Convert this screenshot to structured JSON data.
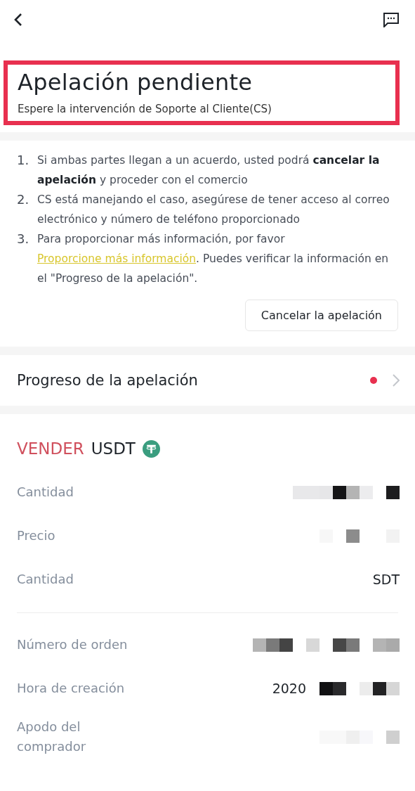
{
  "header": {
    "title": "Apelación pendiente",
    "subtitle": "Espere la intervención de Soporte al Cliente(CS)"
  },
  "steps": [
    {
      "number": "1.",
      "text": "Si ambas partes llegan a un acuerdo, usted podrá **cancelar la apelación** y proceder con el comercio"
    },
    {
      "number": "2.",
      "text": "CS está manejando el caso, asegúrese de tener acceso al correo electrónico y número de teléfono proporcionado"
    },
    {
      "number": "3.",
      "text_before": "Para proporcionar más información, por favor ",
      "link": "Proporcione más información",
      "text_after": ". Puedes verificar la información en el \"Progreso de la apelación\"."
    }
  ],
  "cancel_button": "Cancelar la apelación",
  "progress": {
    "label": "Progreso de la apelación",
    "unread": true
  },
  "trade": {
    "side": "VENDER",
    "asset": "USDT"
  },
  "details": [
    {
      "label": "Cantidad"
    },
    {
      "label": "Precio"
    },
    {
      "label": "Cantidad",
      "value": "SDT"
    }
  ],
  "order": [
    {
      "label": "Número de orden"
    },
    {
      "label": "Hora de creación",
      "value": "2020"
    },
    {
      "label": "Apodo del comprador"
    }
  ]
}
